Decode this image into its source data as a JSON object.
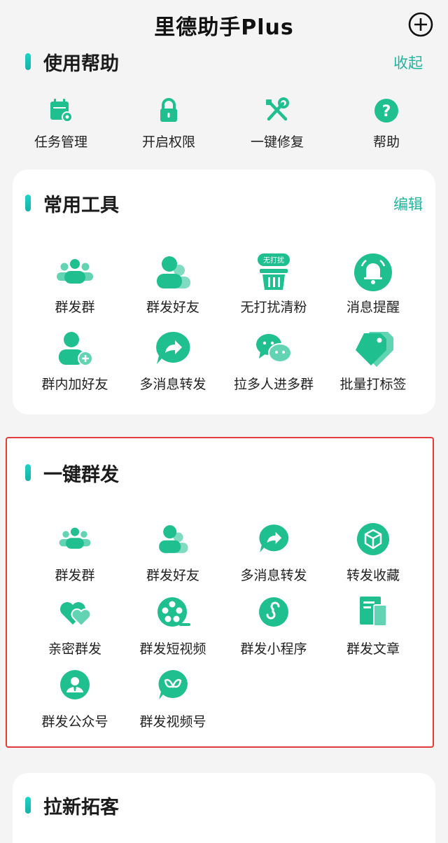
{
  "app": {
    "title": "里德助手Plus"
  },
  "colors": {
    "accent": "#22b39d",
    "icon_green": "#1fbf8f",
    "highlight_border": "#e23b3b"
  },
  "help": {
    "title": "使用帮助",
    "action": "收起",
    "items": [
      {
        "label": "任务管理",
        "icon": "calendar-gear-icon"
      },
      {
        "label": "开启权限",
        "icon": "lock-icon"
      },
      {
        "label": "一键修复",
        "icon": "wrench-screwdriver-icon"
      },
      {
        "label": "帮助",
        "icon": "question-icon"
      }
    ]
  },
  "tools": {
    "title": "常用工具",
    "action": "编辑",
    "dnd_badge": "无打扰",
    "items": [
      {
        "label": "群发群",
        "icon": "group-icon"
      },
      {
        "label": "群发好友",
        "icon": "friends-icon"
      },
      {
        "label": "无打扰清粉",
        "icon": "basket-icon"
      },
      {
        "label": "消息提醒",
        "icon": "bell-icon"
      },
      {
        "label": "群内加好友",
        "icon": "add-friend-icon"
      },
      {
        "label": "多消息转发",
        "icon": "forward-icon"
      },
      {
        "label": "拉多人进多群",
        "icon": "chat-bubbles-icon"
      },
      {
        "label": "批量打标签",
        "icon": "tags-icon"
      }
    ]
  },
  "broadcast": {
    "title": "一键群发",
    "items": [
      {
        "label": "群发群",
        "icon": "group-icon"
      },
      {
        "label": "群发好友",
        "icon": "friends-icon"
      },
      {
        "label": "多消息转发",
        "icon": "forward-icon"
      },
      {
        "label": "转发收藏",
        "icon": "cube-icon"
      },
      {
        "label": "亲密群发",
        "icon": "hearts-icon"
      },
      {
        "label": "群发短视频",
        "icon": "film-reel-icon"
      },
      {
        "label": "群发小程序",
        "icon": "mini-program-icon"
      },
      {
        "label": "群发文章",
        "icon": "article-icon"
      },
      {
        "label": "群发公众号",
        "icon": "official-account-icon"
      },
      {
        "label": "群发视频号",
        "icon": "channels-icon"
      }
    ]
  },
  "acquire": {
    "title": "拉新拓客"
  }
}
